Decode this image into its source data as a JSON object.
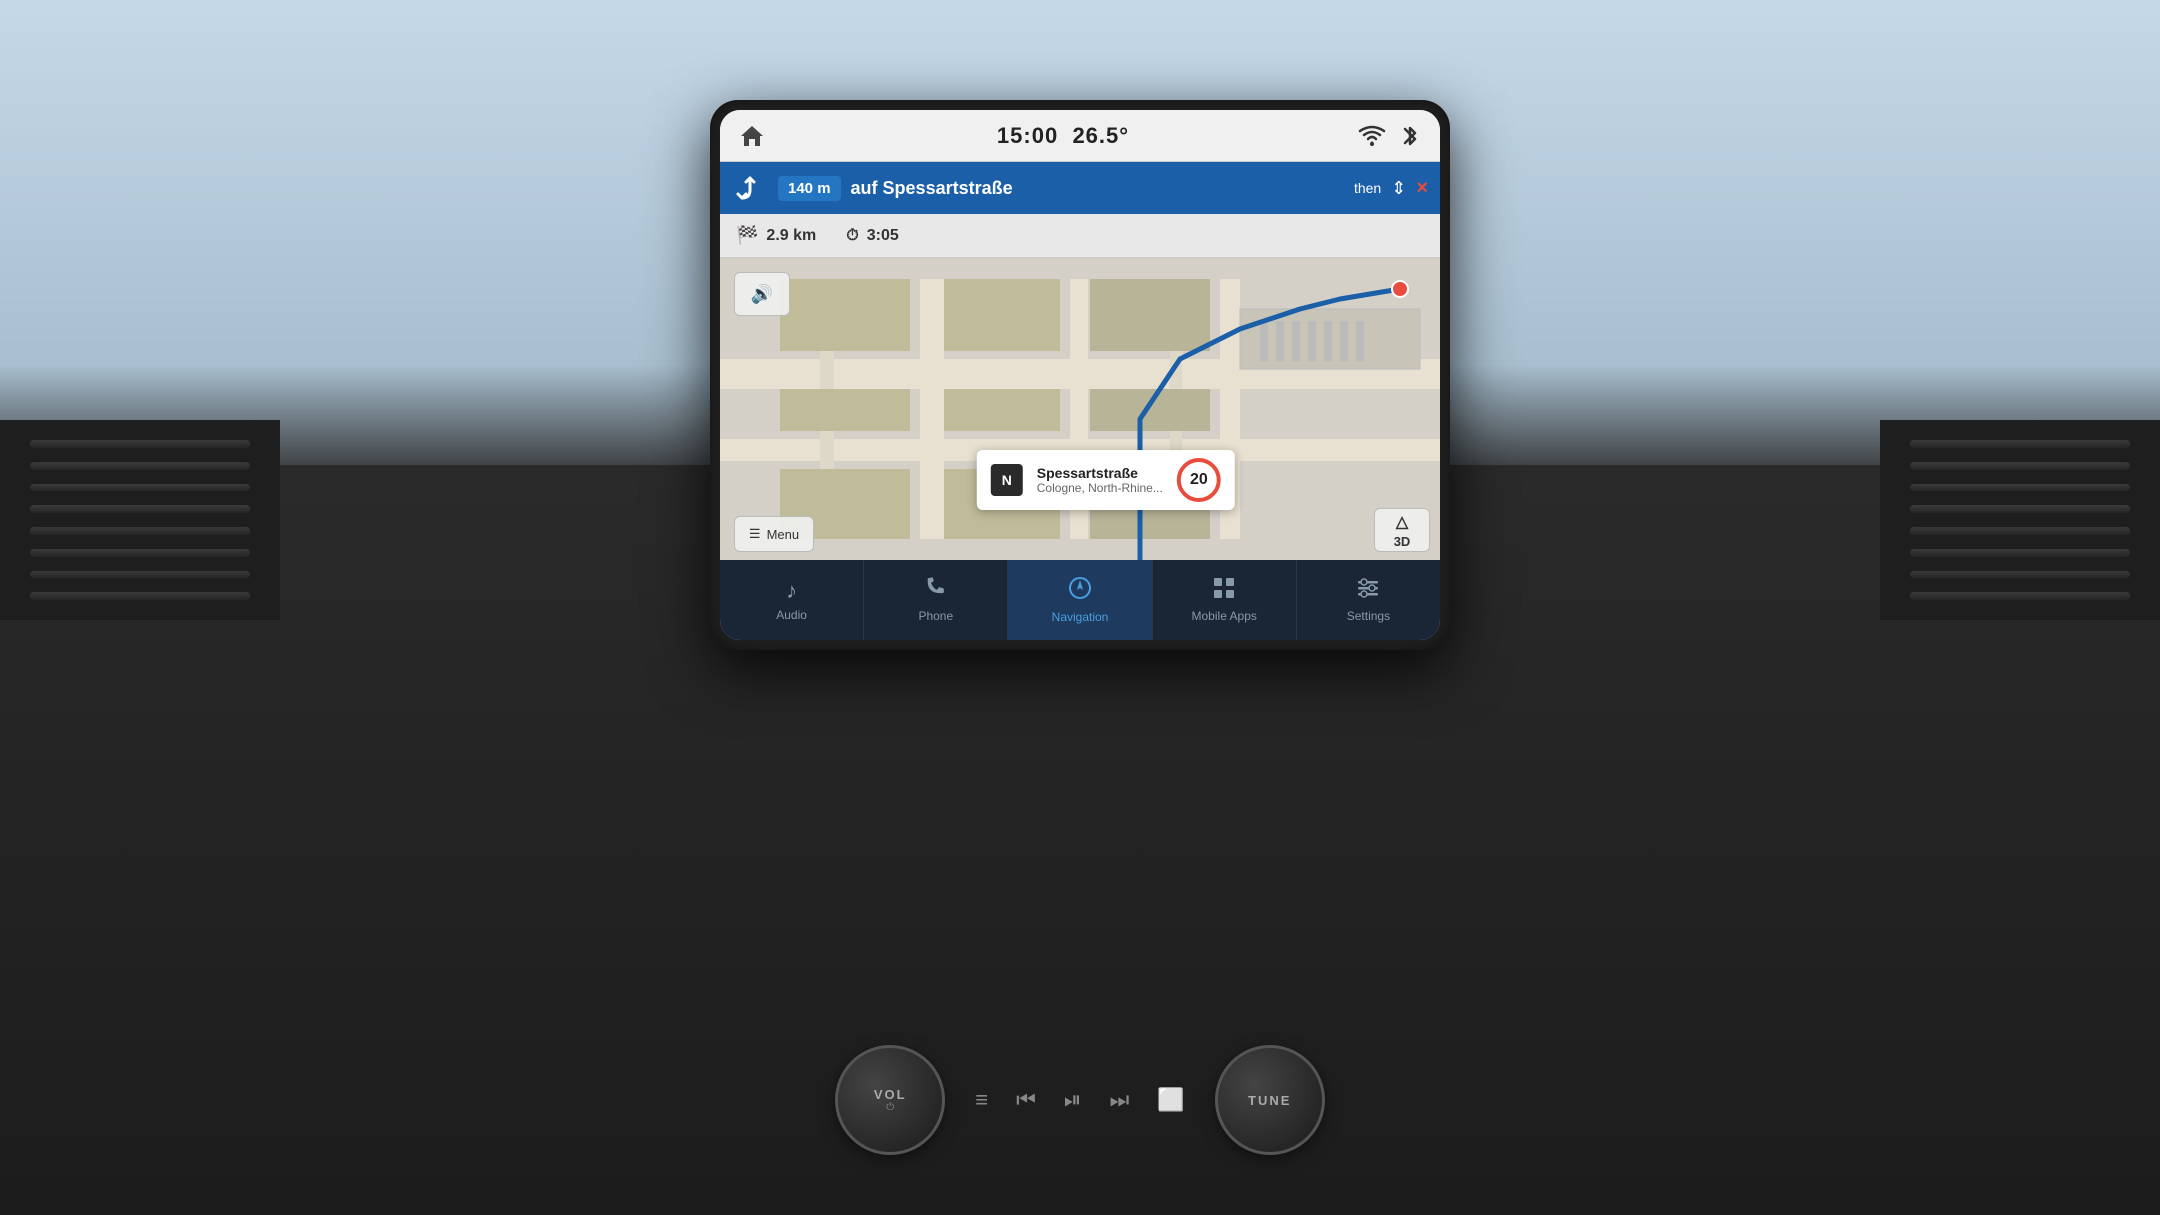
{
  "status_bar": {
    "time": "15:00",
    "temperature": "26.5°",
    "home_label": "home"
  },
  "nav_instruction": {
    "distance": "140 m",
    "street": "auf Spessartstraße",
    "then": "then",
    "close_label": "×"
  },
  "info_bar": {
    "total_distance": "2.9 km",
    "eta": "3:05"
  },
  "map": {
    "compass": "N",
    "street_name": "Spessartstraße",
    "city": "Cologne, North-Rhine...",
    "speed_limit": "20",
    "view_3d": "3D",
    "menu_label": "Menu",
    "volume_icon": "🔊"
  },
  "tabs": [
    {
      "id": "audio",
      "label": "Audio",
      "icon": "♪",
      "active": false
    },
    {
      "id": "phone",
      "label": "Phone",
      "icon": "✆",
      "active": false
    },
    {
      "id": "navigation",
      "label": "Navigation",
      "icon": "⊙",
      "active": true
    },
    {
      "id": "mobile_apps",
      "label": "Mobile Apps",
      "icon": "⊞",
      "active": false
    },
    {
      "id": "settings",
      "label": "Settings",
      "icon": "≡",
      "active": false
    }
  ],
  "knobs": {
    "vol": {
      "label": "VOL",
      "sub": "⏻"
    },
    "tune": {
      "label": "TUNE"
    }
  },
  "media_buttons": [
    "⏮",
    "⏭",
    "⏯",
    "⏩",
    "⬜"
  ],
  "colors": {
    "nav_blue": "#1a5fa8",
    "accent_blue": "#4a9fe0",
    "tab_bg": "#1a2535",
    "active_tab": "#1e3a5f",
    "danger": "#e74c3c"
  }
}
